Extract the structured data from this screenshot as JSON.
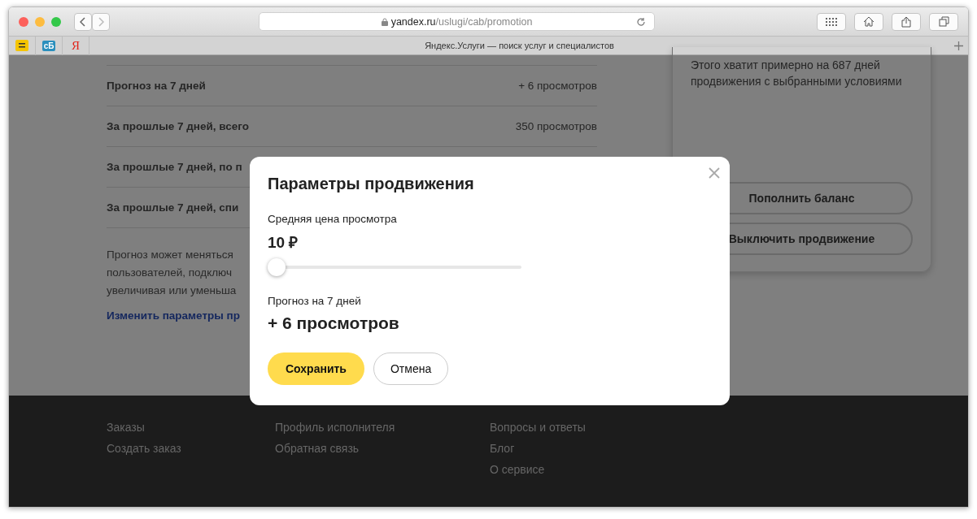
{
  "browser": {
    "url_host": "yandex.ru",
    "url_path": "/uslugi/cab/promotion",
    "tab_title": "Яндекс.Услуги — поиск услуг и специалистов",
    "bookmarks": [
      {
        "kind": "notes"
      },
      {
        "kind": "badge",
        "label": "сБ"
      },
      {
        "kind": "letter",
        "label": "Я"
      }
    ]
  },
  "stats": [
    {
      "label": "Прогноз на 7 дней",
      "value": "+ 6 просмотров"
    },
    {
      "label": "За прошлые 7 дней, всего",
      "value": "350 просмотров"
    },
    {
      "label": "За прошлые 7 дней, по п"
    },
    {
      "label": "За прошлые 7 дней, спи"
    }
  ],
  "note_lines": [
    "Прогноз может меняться",
    "пользователей, подключ",
    "увеличивая или уменьша"
  ],
  "change_link": "Изменить параметры пр",
  "balance_card": {
    "text": "Этого хватит примерно на 687 дней продвижения с выбранными условиями",
    "buttons": [
      "Пополнить баланс",
      "Выключить продвижение"
    ]
  },
  "modal": {
    "title": "Параметры продвижения",
    "price_label": "Средняя цена просмотра",
    "price": "10 ₽",
    "slider": {
      "level": 0
    },
    "forecast_label": "Прогноз на 7 дней",
    "forecast": "+ 6 просмотров",
    "save": "Сохранить",
    "cancel": "Отмена"
  },
  "footer": {
    "columns": [
      [
        "Заказы",
        "Создать заказ"
      ],
      [
        "Профиль исполнителя",
        "Обратная связь"
      ],
      [
        "Вопросы и ответы",
        "Блог",
        "О сервисе"
      ]
    ]
  }
}
